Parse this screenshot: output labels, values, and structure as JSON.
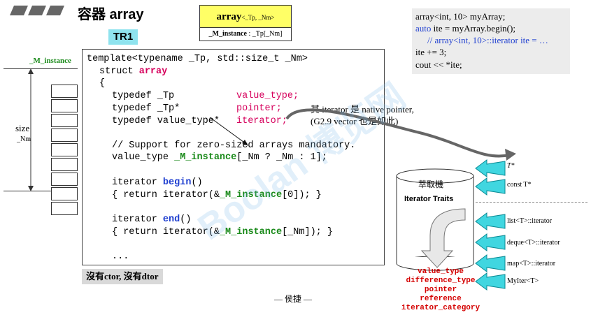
{
  "header": {
    "title": "容器 array",
    "tag": "TR1"
  },
  "class_box": {
    "name": "array",
    "params": "<_Tp, _Nm>",
    "member": "_M_instance",
    "member_type": ": _Tp[_Nm]"
  },
  "usage": {
    "lines": [
      "array<int, 10> myArray;",
      "auto ite = myArray.begin();",
      "// array<int, 10>::iterator ite = …",
      "ite += 3;",
      "cout << *ite;"
    ],
    "keyword_auto": "auto"
  },
  "memory": {
    "label": "_M_instance",
    "size_label": "size",
    "size_sub": "_Nm",
    "cell_count": 9
  },
  "code": {
    "l1": "template<typename _Tp, std::size_t _Nm>",
    "l2_a": "struct ",
    "l2_b": "array",
    "l3": "{",
    "l4_a": "typedef _Tp",
    "l4_b": "value_type;",
    "l5_a": "typedef _Tp*",
    "l5_b": "pointer;",
    "l6_a": "typedef value_type*",
    "l6_b": "iterator;",
    "l7": "// Support for zero-sized arrays mandatory.",
    "l8_a": "value_type ",
    "l8_b": "_M_instance",
    "l8_c": "[_Nm ? _Nm : 1];",
    "l9_a": "iterator ",
    "l9_b": "begin",
    "l9_c": "()",
    "l10_a": "{ return iterator(&",
    "l10_b": "_M_instance",
    "l10_c": "[0]); }",
    "l11_a": "iterator ",
    "l11_b": "end",
    "l11_c": "()",
    "l12_a": "{ return iterator(&",
    "l12_b": "_M_instance",
    "l12_c": "[_Nm]); }",
    "l13": "..."
  },
  "note": {
    "line1": "其 iterator 是 native pointer,",
    "line2": "(G2.9 vector 也是如此)"
  },
  "footer_note": "沒有ctor, 沒有dtor",
  "author": "— 侯捷 —",
  "traits": {
    "box_title": "萃取機",
    "box_name": "Iterator Traits",
    "inputs": [
      "T*",
      "const T*",
      "list<T>::iterator",
      "deque<T>::iterator",
      "map<T>::iterator",
      "MyIter<T>"
    ],
    "outputs": [
      "value_type",
      "difference_type",
      "pointer",
      "reference",
      "iterator_category"
    ]
  },
  "colors": {
    "keyword": "#d6005c",
    "member": "#1a8a1a",
    "method": "#1f3fd0",
    "class_box_fill": "#ffff66",
    "tag_fill": "#8fe3ee",
    "arrow_fill": "#40d6e0",
    "trait_output": "#d40000",
    "usage_fill": "#ececec"
  },
  "watermark": "Boolan 博览网"
}
